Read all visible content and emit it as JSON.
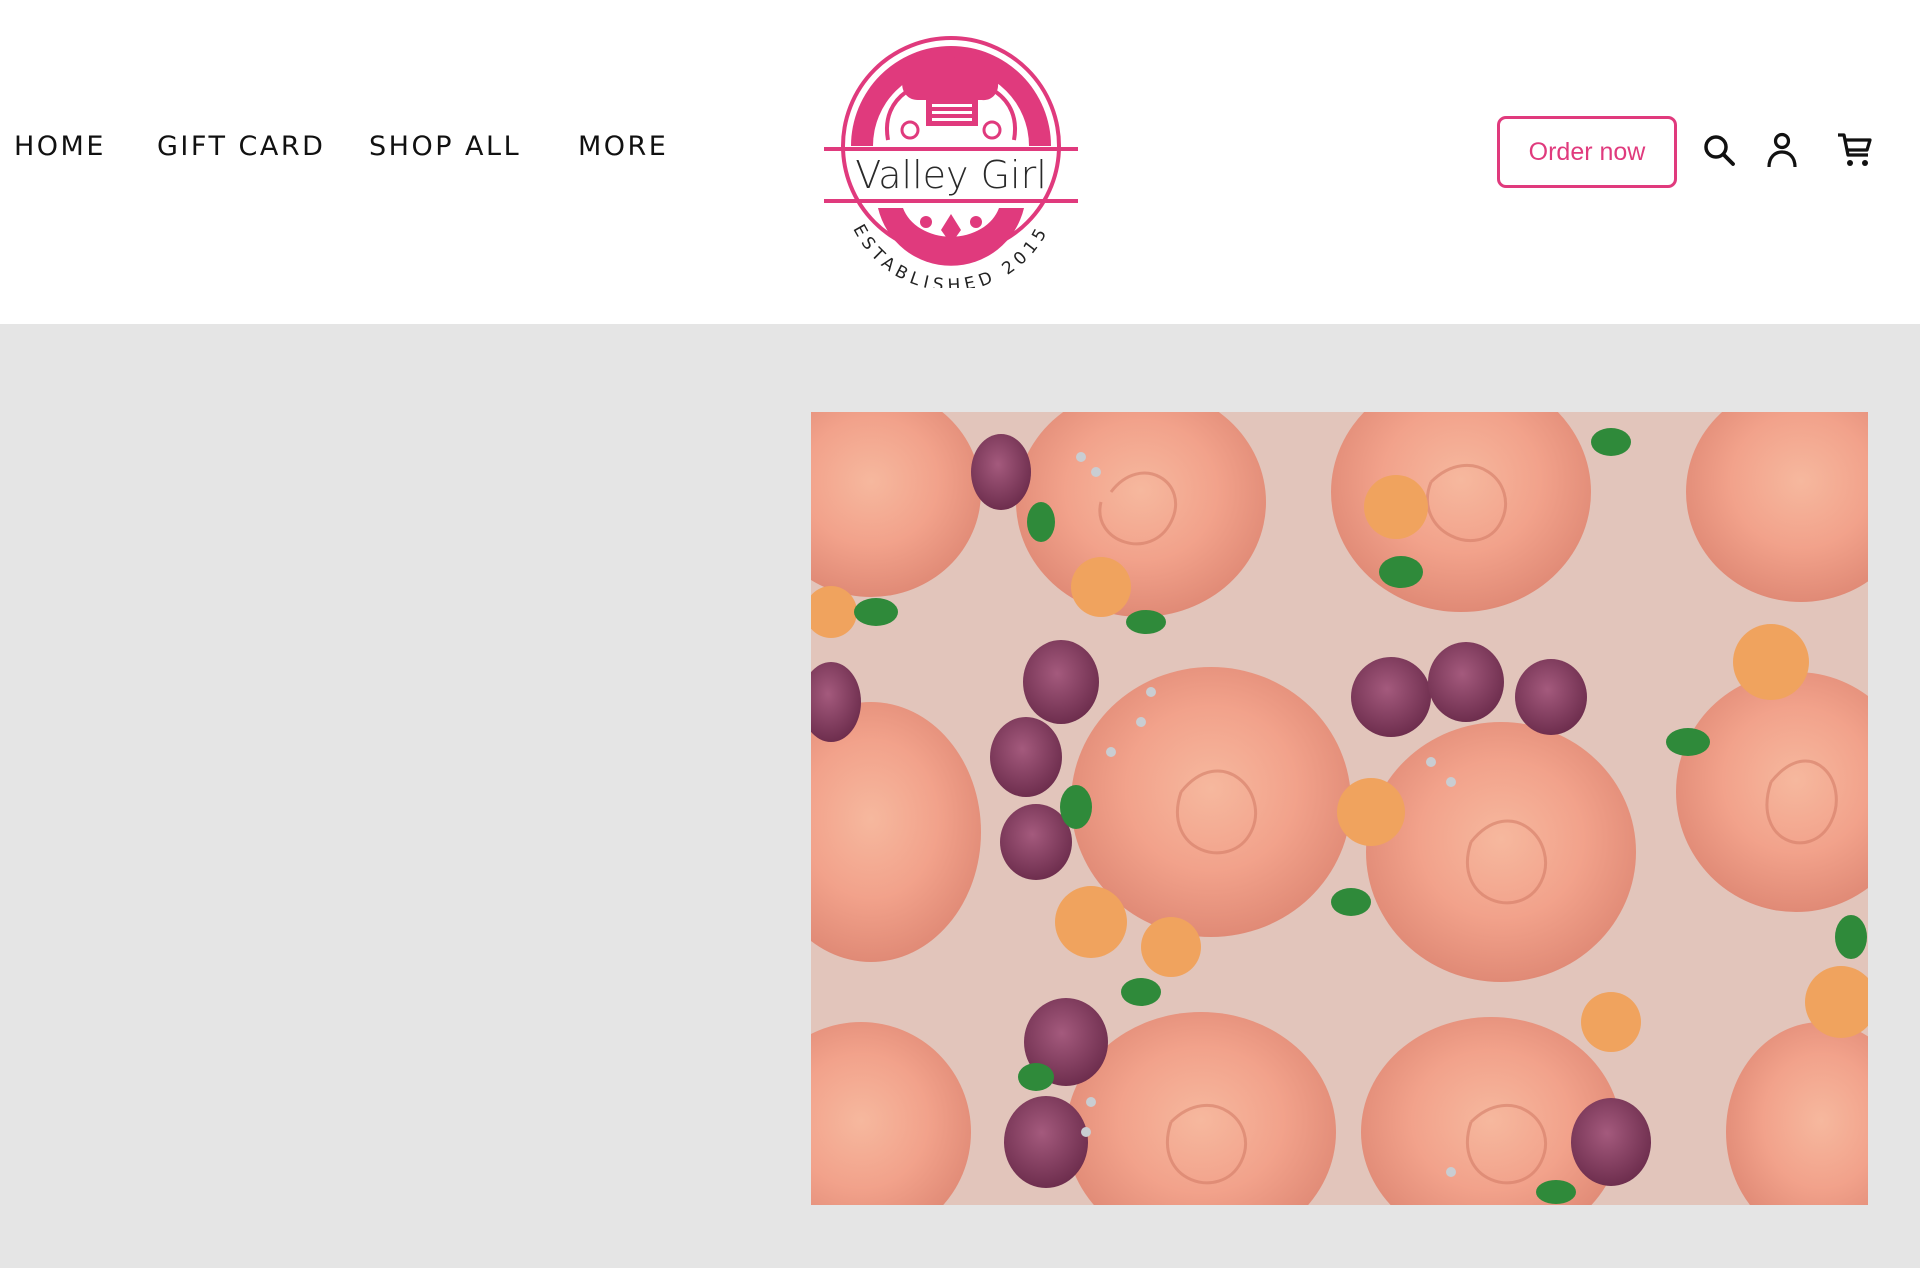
{
  "nav": {
    "items": [
      {
        "label": "HOME"
      },
      {
        "label": "GIFT CARD"
      },
      {
        "label": "SHOP ALL"
      },
      {
        "label": "MORE"
      }
    ]
  },
  "logo": {
    "name": "Valley Girl",
    "tagline": "ESTABLISHED 2015"
  },
  "actions": {
    "order_label": "Order now",
    "icons": [
      "search-icon",
      "account-icon",
      "cart-icon"
    ]
  },
  "hero": {
    "image": "cupcakes-rose-frosting-photo"
  },
  "colors": {
    "brand": "#e03a7d",
    "page_bg": "#e5e5e5",
    "header_bg": "#ffffff"
  }
}
